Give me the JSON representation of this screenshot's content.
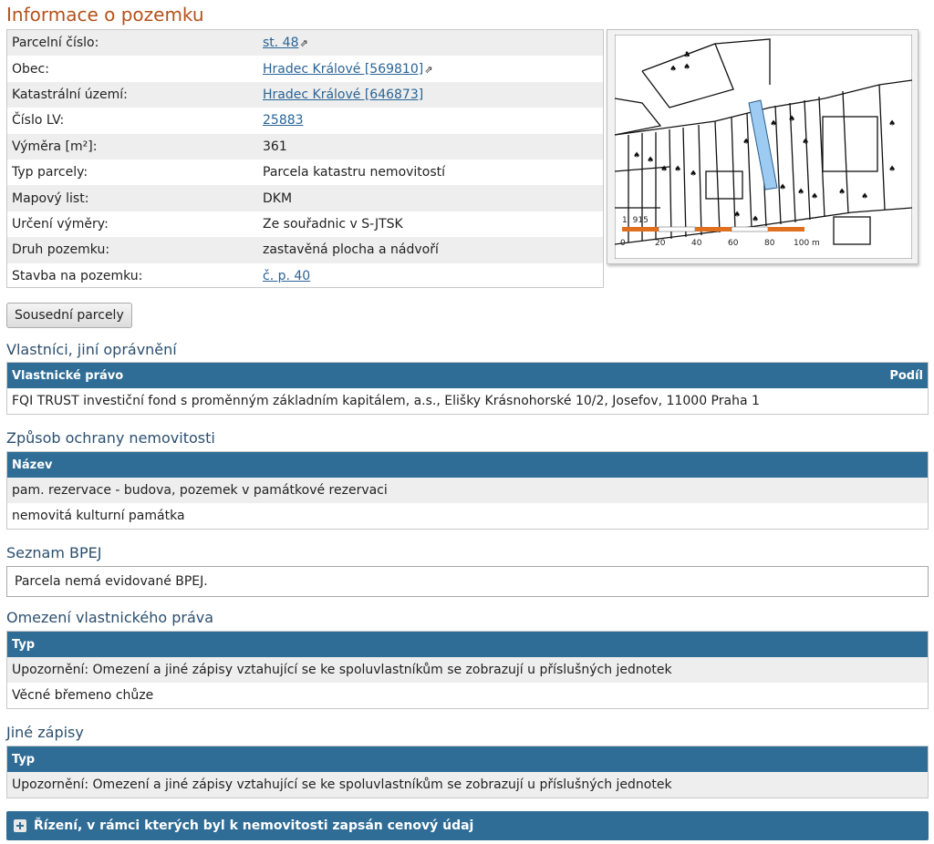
{
  "title": "Informace o pozemku",
  "info": [
    {
      "label": "Parcelní číslo:",
      "value": "st. 48",
      "link": true,
      "ext": true
    },
    {
      "label": "Obec:",
      "value": "Hradec Králové [569810]",
      "link": true,
      "ext": true
    },
    {
      "label": "Katastrální území:",
      "value": "Hradec Králové [646873]",
      "link": true,
      "ext": false
    },
    {
      "label": "Číslo LV:",
      "value": "25883",
      "link": true,
      "ext": false
    },
    {
      "label": "Výměra [m²]:",
      "value": "361",
      "link": false,
      "ext": false
    },
    {
      "label": "Typ parcely:",
      "value": "Parcela katastru nemovitostí",
      "link": false,
      "ext": false
    },
    {
      "label": "Mapový list:",
      "value": "DKM",
      "link": false,
      "ext": false
    },
    {
      "label": "Určení výměry:",
      "value": "Ze souřadnic v S-JTSK",
      "link": false,
      "ext": false
    },
    {
      "label": "Druh pozemku:",
      "value": "zastavěná plocha a nádvoří",
      "link": false,
      "ext": false
    },
    {
      "label": "Stavba na pozemku:",
      "value": "č. p. 40",
      "link": true,
      "ext": false
    }
  ],
  "ext_icon": "⇗",
  "map": {
    "scale_label": "1: 915",
    "scale_ticks": [
      "0",
      "20",
      "40",
      "60",
      "80",
      "100 m"
    ]
  },
  "neighbors_button": "Sousední parcely",
  "owners": {
    "heading": "Vlastníci, jiní oprávnění",
    "col_left": "Vlastnické právo",
    "col_right": "Podíl",
    "rows": [
      "FQI TRUST investiční fond s proměnným základním kapitálem, a.s., Elišky Krásnohorské 10/2, Josefov, 11000 Praha 1"
    ]
  },
  "protection": {
    "heading": "Způsob ochrany nemovitosti",
    "col": "Název",
    "rows": [
      "pam. rezervace - budova, pozemek v památkové rezervaci",
      "nemovitá kulturní památka"
    ]
  },
  "bpej": {
    "heading": "Seznam BPEJ",
    "text": "Parcela nemá evidované BPEJ."
  },
  "restrictions": {
    "heading": "Omezení vlastnického práva",
    "col": "Typ",
    "rows": [
      "Upozornění: Omezení a jiné zápisy vztahující se ke spoluvlastníkům se zobrazují u příslušných jednotek",
      "Věcné břemeno chůze"
    ]
  },
  "other": {
    "heading": "Jiné zápisy",
    "col": "Typ",
    "rows": [
      "Upozornění: Omezení a jiné zápisy vztahující se ke spoluvlastníkům se zobrazují u příslušných jednotek"
    ]
  },
  "accordion_label": "Řízení, v rámci kterých byl k nemovitosti zapsán cenový údaj",
  "colors": {
    "title": "#b5521b",
    "header": "#2f6d96",
    "link": "#2a6496",
    "highlight": "#9ecbf2",
    "scale": "#e07020"
  }
}
